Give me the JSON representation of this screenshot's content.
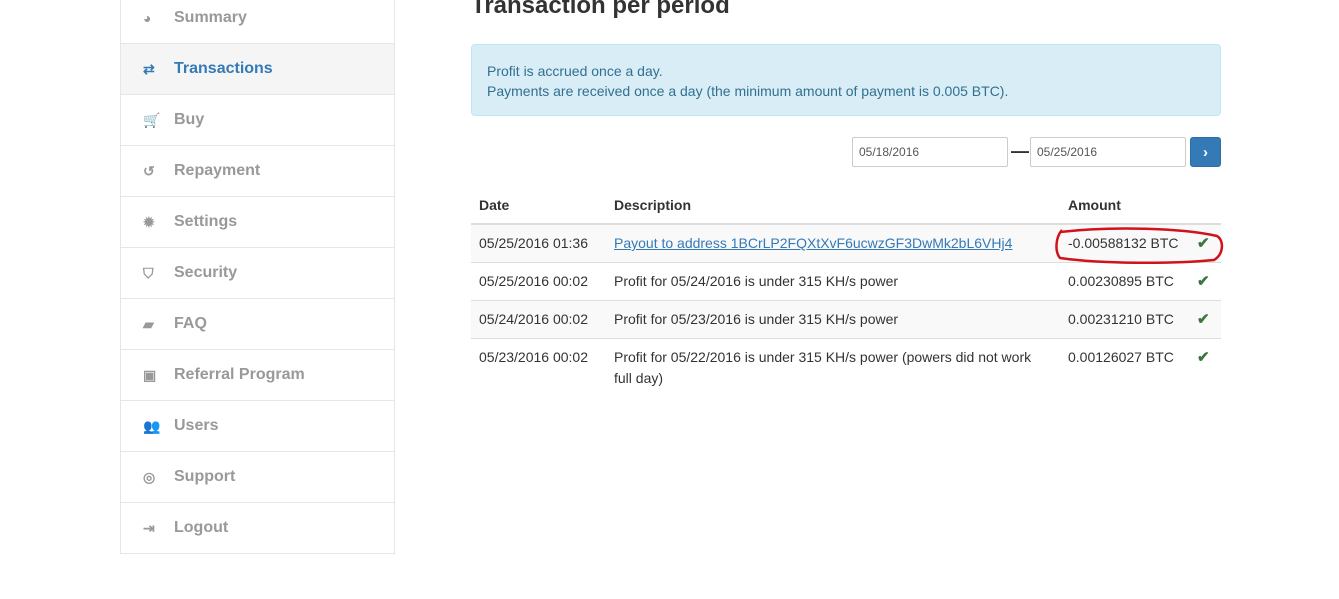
{
  "sidebar": {
    "items": [
      {
        "label": "Summary",
        "icon": "dashboard-icon",
        "glyph": "◕"
      },
      {
        "label": "Transactions",
        "icon": "exchange-icon",
        "glyph": "⇄",
        "active": true
      },
      {
        "label": "Buy",
        "icon": "cart-icon",
        "glyph": "🛒"
      },
      {
        "label": "Repayment",
        "icon": "history-icon",
        "glyph": "↺"
      },
      {
        "label": "Settings",
        "icon": "gear-icon",
        "glyph": "✹"
      },
      {
        "label": "Security",
        "icon": "shield-icon",
        "glyph": "⛉"
      },
      {
        "label": "FAQ",
        "icon": "book-icon",
        "glyph": "▰"
      },
      {
        "label": "Referral Program",
        "icon": "money-icon",
        "glyph": "▣"
      },
      {
        "label": "Users",
        "icon": "users-icon",
        "glyph": "👥"
      },
      {
        "label": "Support",
        "icon": "life-ring-icon",
        "glyph": "◎"
      },
      {
        "label": "Logout",
        "icon": "sign-out-icon",
        "glyph": "⇥"
      }
    ]
  },
  "main": {
    "title": "Transaction per period",
    "alert": {
      "line1": "Profit is accrued once a day.",
      "line2": "Payments are received once a day (the minimum amount of payment is 0.005 BTC)."
    },
    "filter": {
      "from": "05/18/2016",
      "to": "05/25/2016",
      "separator": "—",
      "submit_glyph": "›"
    },
    "table": {
      "headers": [
        "Date",
        "Description",
        "Amount",
        ""
      ],
      "rows": [
        {
          "date": "05/25/2016 01:36",
          "description": "Payout to address 1BCrLP2FQXtXvF6ucwzGF3DwMk2bL6VHj4",
          "amount": "-0.00588132 BTC",
          "status": "✔"
        },
        {
          "date": "05/25/2016 00:02",
          "description": "Profit for 05/24/2016 is under 315 KH/s power",
          "amount": "0.00230895 BTC",
          "status": "✔"
        },
        {
          "date": "05/24/2016 00:02",
          "description": "Profit for 05/23/2016 is under 315 KH/s power",
          "amount": "0.00231210 BTC",
          "status": "✔"
        },
        {
          "date": "05/23/2016 00:02",
          "description": "Profit for 05/22/2016 is under 315 KH/s power (powers did not work full day)",
          "amount": "0.00126027 BTC",
          "status": "✔"
        }
      ]
    }
  },
  "colors": {
    "accent": "#337ab7",
    "success": "#3c763d",
    "annotation": "#d0121b"
  }
}
